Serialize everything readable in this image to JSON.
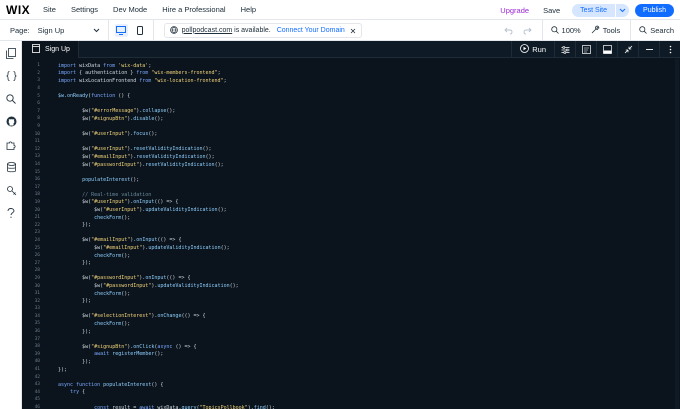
{
  "topbar": {
    "logo": "WIX",
    "menu": [
      "Site",
      "Settings",
      "Dev Mode",
      "Hire a Professional",
      "Help"
    ],
    "upgrade": "Upgrade",
    "save": "Save",
    "test_site": "Test Site",
    "publish": "Publish"
  },
  "secondbar": {
    "page_label": "Page:",
    "page_value": "Sign Up",
    "url": "pollpodcast.com",
    "url_status": "is available.",
    "connect": "Connect Your Domain",
    "zoom": "100%",
    "tools": "Tools",
    "search": "Search"
  },
  "editor": {
    "tab_label": "Sign Up",
    "run_label": "Run"
  },
  "code_lines": [
    {
      "n": "1",
      "segs": [
        [
          "kw",
          "import"
        ],
        [
          "txt",
          " wixData "
        ],
        [
          "kw",
          "from"
        ],
        [
          "txt",
          " "
        ],
        [
          "str",
          "'wix-data'"
        ],
        [
          "txt",
          ";"
        ]
      ]
    },
    {
      "n": "2",
      "segs": [
        [
          "kw",
          "import"
        ],
        [
          "txt",
          " { authentication } "
        ],
        [
          "kw",
          "from"
        ],
        [
          "txt",
          " "
        ],
        [
          "str",
          "\"wix-members-frontend\""
        ],
        [
          "txt",
          ";"
        ]
      ]
    },
    {
      "n": "3",
      "segs": [
        [
          "kw",
          "import"
        ],
        [
          "txt",
          " wixLocationFrontend "
        ],
        [
          "kw",
          "from"
        ],
        [
          "txt",
          " "
        ],
        [
          "str",
          "\"wix-location-frontend\""
        ],
        [
          "txt",
          ";"
        ]
      ]
    },
    {
      "n": "4",
      "segs": []
    },
    {
      "n": "5",
      "segs": [
        [
          "fn",
          "$w.onReady"
        ],
        [
          "txt",
          "("
        ],
        [
          "kw",
          "function"
        ],
        [
          "txt",
          " () {"
        ]
      ]
    },
    {
      "n": "6",
      "segs": []
    },
    {
      "n": "7",
      "segs": [
        [
          "txt",
          "        $w("
        ],
        [
          "str",
          "\"#errorMessage\""
        ],
        [
          "txt",
          ")."
        ],
        [
          "fn",
          "collapse"
        ],
        [
          "txt",
          "();"
        ]
      ]
    },
    {
      "n": "8",
      "segs": [
        [
          "txt",
          "        $w("
        ],
        [
          "str",
          "\"#signupBtn\""
        ],
        [
          "txt",
          ")."
        ],
        [
          "fn",
          "disable"
        ],
        [
          "txt",
          "();"
        ]
      ]
    },
    {
      "n": "9",
      "segs": []
    },
    {
      "n": "10",
      "segs": [
        [
          "txt",
          "        $w("
        ],
        [
          "str",
          "\"#userInput\""
        ],
        [
          "txt",
          ")."
        ],
        [
          "fn",
          "focus"
        ],
        [
          "txt",
          "();"
        ]
      ]
    },
    {
      "n": "11",
      "segs": []
    },
    {
      "n": "12",
      "segs": [
        [
          "txt",
          "        $w("
        ],
        [
          "str",
          "\"#userInput\""
        ],
        [
          "txt",
          ")."
        ],
        [
          "fn",
          "resetValidityIndication"
        ],
        [
          "txt",
          "();"
        ]
      ]
    },
    {
      "n": "13",
      "segs": [
        [
          "txt",
          "        $w("
        ],
        [
          "str",
          "\"#emailInput\""
        ],
        [
          "txt",
          ")."
        ],
        [
          "fn",
          "resetValidityIndication"
        ],
        [
          "txt",
          "();"
        ]
      ]
    },
    {
      "n": "14",
      "segs": [
        [
          "txt",
          "        $w("
        ],
        [
          "str",
          "\"#passwordInput\""
        ],
        [
          "txt",
          ")."
        ],
        [
          "fn",
          "resetValidityIndication"
        ],
        [
          "txt",
          "();"
        ]
      ]
    },
    {
      "n": "15",
      "segs": []
    },
    {
      "n": "16",
      "segs": [
        [
          "txt",
          "        "
        ],
        [
          "fn",
          "populateInterest"
        ],
        [
          "txt",
          "();"
        ]
      ]
    },
    {
      "n": "17",
      "segs": []
    },
    {
      "n": "18",
      "segs": [
        [
          "com",
          "        // Real-time validation"
        ]
      ]
    },
    {
      "n": "19",
      "segs": [
        [
          "txt",
          "        $w("
        ],
        [
          "str",
          "\"#userInput\""
        ],
        [
          "txt",
          ")."
        ],
        [
          "fn",
          "onInput"
        ],
        [
          "txt",
          "(() => {"
        ]
      ]
    },
    {
      "n": "20",
      "segs": [
        [
          "txt",
          "            $w("
        ],
        [
          "str",
          "\"#userInput\""
        ],
        [
          "txt",
          ")."
        ],
        [
          "fn",
          "updateValidityIndication"
        ],
        [
          "txt",
          "();"
        ]
      ]
    },
    {
      "n": "21",
      "segs": [
        [
          "txt",
          "            "
        ],
        [
          "fn",
          "checkForm"
        ],
        [
          "txt",
          "();"
        ]
      ]
    },
    {
      "n": "22",
      "segs": [
        [
          "txt",
          "        });"
        ]
      ]
    },
    {
      "n": "23",
      "segs": []
    },
    {
      "n": "24",
      "segs": [
        [
          "txt",
          "        $w("
        ],
        [
          "str",
          "\"#emailInput\""
        ],
        [
          "txt",
          ")."
        ],
        [
          "fn",
          "onInput"
        ],
        [
          "txt",
          "(() => {"
        ]
      ]
    },
    {
      "n": "25",
      "segs": [
        [
          "txt",
          "            $w("
        ],
        [
          "str",
          "\"#emailInput\""
        ],
        [
          "txt",
          ")."
        ],
        [
          "fn",
          "updateValidityIndication"
        ],
        [
          "txt",
          "();"
        ]
      ]
    },
    {
      "n": "26",
      "segs": [
        [
          "txt",
          "            "
        ],
        [
          "fn",
          "checkForm"
        ],
        [
          "txt",
          "();"
        ]
      ]
    },
    {
      "n": "27",
      "segs": [
        [
          "txt",
          "        });"
        ]
      ]
    },
    {
      "n": "28",
      "segs": []
    },
    {
      "n": "29",
      "segs": [
        [
          "txt",
          "        $w("
        ],
        [
          "str",
          "\"#passwordInput\""
        ],
        [
          "txt",
          ")."
        ],
        [
          "fn",
          "onInput"
        ],
        [
          "txt",
          "(() => {"
        ]
      ]
    },
    {
      "n": "30",
      "segs": [
        [
          "txt",
          "            $w("
        ],
        [
          "str",
          "\"#passwordInput\""
        ],
        [
          "txt",
          ")."
        ],
        [
          "fn",
          "updateValidityIndication"
        ],
        [
          "txt",
          "();"
        ]
      ]
    },
    {
      "n": "31",
      "segs": [
        [
          "txt",
          "            "
        ],
        [
          "fn",
          "checkForm"
        ],
        [
          "txt",
          "();"
        ]
      ]
    },
    {
      "n": "32",
      "segs": [
        [
          "txt",
          "        });"
        ]
      ]
    },
    {
      "n": "33",
      "segs": []
    },
    {
      "n": "34",
      "segs": [
        [
          "txt",
          "        $w("
        ],
        [
          "str",
          "\"#selectionInterest\""
        ],
        [
          "txt",
          ")."
        ],
        [
          "fn",
          "onChange"
        ],
        [
          "txt",
          "(() => {"
        ]
      ]
    },
    {
      "n": "35",
      "segs": [
        [
          "txt",
          "            "
        ],
        [
          "fn",
          "checkForm"
        ],
        [
          "txt",
          "();"
        ]
      ]
    },
    {
      "n": "36",
      "segs": [
        [
          "txt",
          "        });"
        ]
      ]
    },
    {
      "n": "37",
      "segs": []
    },
    {
      "n": "38",
      "segs": [
        [
          "txt",
          "        $w("
        ],
        [
          "str",
          "\"#signupBtn\""
        ],
        [
          "txt",
          ")."
        ],
        [
          "fn",
          "onClick"
        ],
        [
          "txt",
          "("
        ],
        [
          "kw",
          "async"
        ],
        [
          "txt",
          " () => {"
        ]
      ]
    },
    {
      "n": "39",
      "segs": [
        [
          "txt",
          "            "
        ],
        [
          "kw",
          "await"
        ],
        [
          "txt",
          " "
        ],
        [
          "fn",
          "registerMember"
        ],
        [
          "txt",
          "();"
        ]
      ]
    },
    {
      "n": "40",
      "segs": [
        [
          "txt",
          "        });"
        ]
      ]
    },
    {
      "n": "41",
      "segs": [
        [
          "txt",
          "});"
        ]
      ]
    },
    {
      "n": "42",
      "segs": []
    },
    {
      "n": "43",
      "segs": [
        [
          "kw",
          "async function"
        ],
        [
          "txt",
          " "
        ],
        [
          "fn",
          "populateInterest"
        ],
        [
          "txt",
          "() {"
        ]
      ]
    },
    {
      "n": "44",
      "segs": [
        [
          "txt",
          "    "
        ],
        [
          "kw",
          "try"
        ],
        [
          "txt",
          " {"
        ]
      ]
    },
    {
      "n": "45",
      "segs": []
    },
    {
      "n": "46",
      "segs": [
        [
          "txt",
          "            "
        ],
        [
          "kw",
          "const"
        ],
        [
          "txt",
          " result = "
        ],
        [
          "kw",
          "await"
        ],
        [
          "txt",
          " wixData."
        ],
        [
          "fn",
          "query"
        ],
        [
          "txt",
          "("
        ],
        [
          "str",
          "\"TopicsPollbook\""
        ],
        [
          "txt",
          ")."
        ],
        [
          "fn",
          "find"
        ],
        [
          "txt",
          "();"
        ]
      ]
    }
  ],
  "colors": {
    "accent": "#116dff",
    "upgrade": "#9a27d5",
    "editor_bg": "#0b141d"
  }
}
